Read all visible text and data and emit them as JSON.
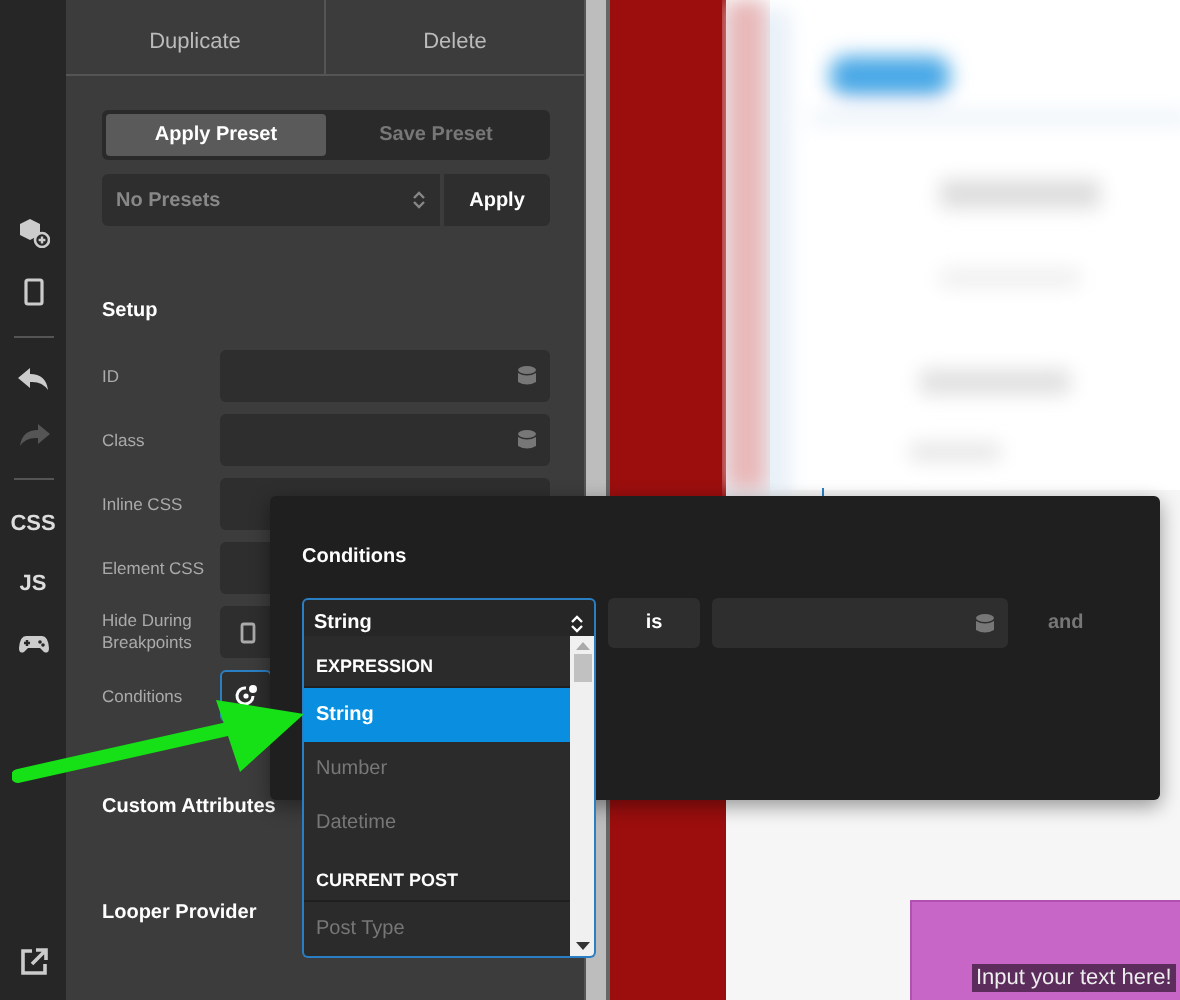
{
  "sidebar": {
    "undo": {
      "disabled": false
    },
    "redo": {
      "disabled": true
    },
    "labels": [
      "CSS",
      "JS"
    ]
  },
  "actions": [
    "Duplicate",
    "Delete"
  ],
  "preset_tabs": [
    {
      "label": "Apply Preset",
      "selected": true
    },
    {
      "label": "Save Preset",
      "selected": false
    }
  ],
  "preset_select": {
    "value": "No Presets",
    "button": "Apply"
  },
  "setup": {
    "title": "Setup",
    "fields": [
      {
        "label": "ID",
        "kind": "text"
      },
      {
        "label": "Class",
        "kind": "text"
      },
      {
        "label": "Inline CSS",
        "kind": "code"
      },
      {
        "label": "Element CSS",
        "kind": "code"
      },
      {
        "label": "Hide During Breakpoints",
        "kind": "breakpoints"
      },
      {
        "label": "Conditions",
        "kind": "conditions"
      }
    ]
  },
  "sections": [
    "Custom Attributes",
    "Looper Provider"
  ],
  "conditions_popup": {
    "title": "Conditions",
    "select_value": "String",
    "operator": "is",
    "joiner": "and",
    "groups": [
      {
        "heading": "EXPRESSION",
        "options": [
          {
            "label": "String",
            "selected": true
          },
          {
            "label": "Number",
            "selected": false
          },
          {
            "label": "Datetime",
            "selected": false
          }
        ]
      },
      {
        "heading": "CURRENT POST",
        "options": [
          {
            "label": "Post Type",
            "selected": false
          }
        ]
      }
    ]
  },
  "canvas": {
    "text_block": "Input your text here!"
  }
}
